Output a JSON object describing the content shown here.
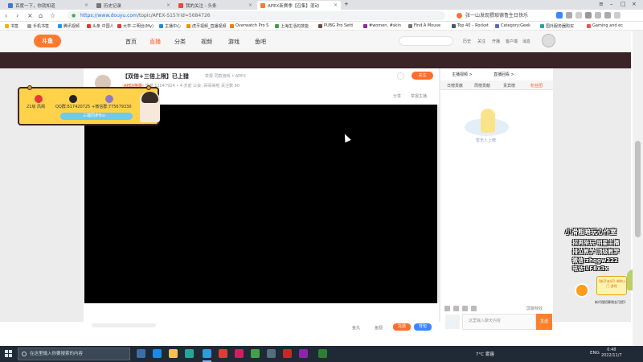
{
  "browser": {
    "tabs": [
      {
        "label": "百度一下，你就知道",
        "active": false
      },
      {
        "label": "历史记录",
        "active": false
      },
      {
        "label": "我的关注 - 头条",
        "active": false
      },
      {
        "label": "APEX新赛季【召集】混动",
        "active": true
      }
    ],
    "url_host": "https://www.douyu.com",
    "url_path": "/topic/APEX-S15?rid=5684726",
    "omni_search": "张一山发现猥琐德鲁生日快乐",
    "bookmarks": [
      "书签",
      "手机书签",
      "腾讯视频",
      "头条 中国人",
      "大学-三明治(My)",
      "主播中心",
      "虎牙视频_直播视频",
      "Overwatch Pro S",
      "上海生活的技能",
      "PUBG Pro Setti",
      "#women, #skin",
      "Find A Mouse",
      "Top 40 – Rocket",
      "Category:Geek",
      "国外服务器购买",
      "Gaming and ec"
    ]
  },
  "site": {
    "logo": "斗鱼",
    "nav": [
      {
        "label": "首页",
        "active": false
      },
      {
        "label": "直播",
        "active": true
      },
      {
        "label": "分类",
        "active": false
      },
      {
        "label": "视频",
        "active": false
      },
      {
        "label": "游戏",
        "active": false
      },
      {
        "label": "鱼吧",
        "active": false
      }
    ],
    "header_links": [
      "历史",
      "关注",
      "开播",
      "客户端",
      "消息"
    ]
  },
  "room": {
    "title": "【双倍+三倍上限】已上猎",
    "title_tag": "举报  同款游戏 • APEX",
    "meta": {
      "hot": "热度 11047924",
      "hot_badge": "APEX英雄",
      "level": "• 4 天前",
      "notice": "公会: 哥哥来啦",
      "followers": "关注数 60"
    },
    "follow_label": "关注",
    "share_label": "分享",
    "report_label": "举报主播",
    "gift_meta": [
      "鱼丸",
      "鱼翅"
    ],
    "gift_buttons": [
      {
        "label": "充值",
        "color": "#ff6e2c"
      },
      {
        "label": "背包",
        "color": "#3a87ff"
      }
    ]
  },
  "profile_card": {
    "items": [
      {
        "label": "21级 风阁"
      },
      {
        "label": "QQ群:817420725"
      },
      {
        "label": "+微信群:775679330"
      }
    ],
    "platforms": "三端同步Biu"
  },
  "right_panel": {
    "top_tabs": [
      "主播视频 >",
      "直播回看 >"
    ],
    "tabs": [
      {
        "label": "日榜贡献",
        "active": false
      },
      {
        "label": "周榜贡献",
        "active": false
      },
      {
        "label": "贵宾榜",
        "active": false
      },
      {
        "label": "粉丝团",
        "active": true
      }
    ],
    "empty_text": "暂无人上榜",
    "chat_placeholder": "这里输入聊天内容",
    "chat_send": "发送",
    "block_label": "屏蔽特效"
  },
  "promo": {
    "lines": [
      "小滑粗暗玩心作室",
      "招男陪玩 明星主播",
      "排位教学 顶级教学",
      "微信:zhqgw222",
      "电话:LF8x3x"
    ],
    "sticker": "【新手友好】带你入门 游戏",
    "footer": "新代理招募佣金可提1"
  },
  "taskbar": {
    "search_placeholder": "在这里输入你要搜索的内容",
    "weather": "7°C 雾霾",
    "language": "ENG",
    "time": "0:48",
    "date": "2022/11/7"
  }
}
